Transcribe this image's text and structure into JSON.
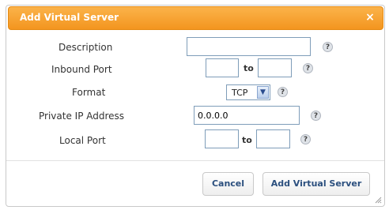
{
  "dialog": {
    "title": "Add Virtual Server",
    "close_glyph": "×"
  },
  "form": {
    "description": {
      "label": "Description",
      "value": ""
    },
    "inbound_port": {
      "label": "Inbound Port",
      "from": "",
      "to_label": "to",
      "to": ""
    },
    "format": {
      "label": "Format",
      "selected": "TCP"
    },
    "private_ip": {
      "label": "Private IP Address",
      "value": "0.0.0.0"
    },
    "local_port": {
      "label": "Local Port",
      "from": "",
      "to_label": "to",
      "to": ""
    },
    "help_glyph": "?"
  },
  "buttons": {
    "cancel": "Cancel",
    "add": "Add Virtual Server"
  },
  "colors": {
    "titlebar": "#f3951f",
    "button_text": "#2b4f7e"
  }
}
